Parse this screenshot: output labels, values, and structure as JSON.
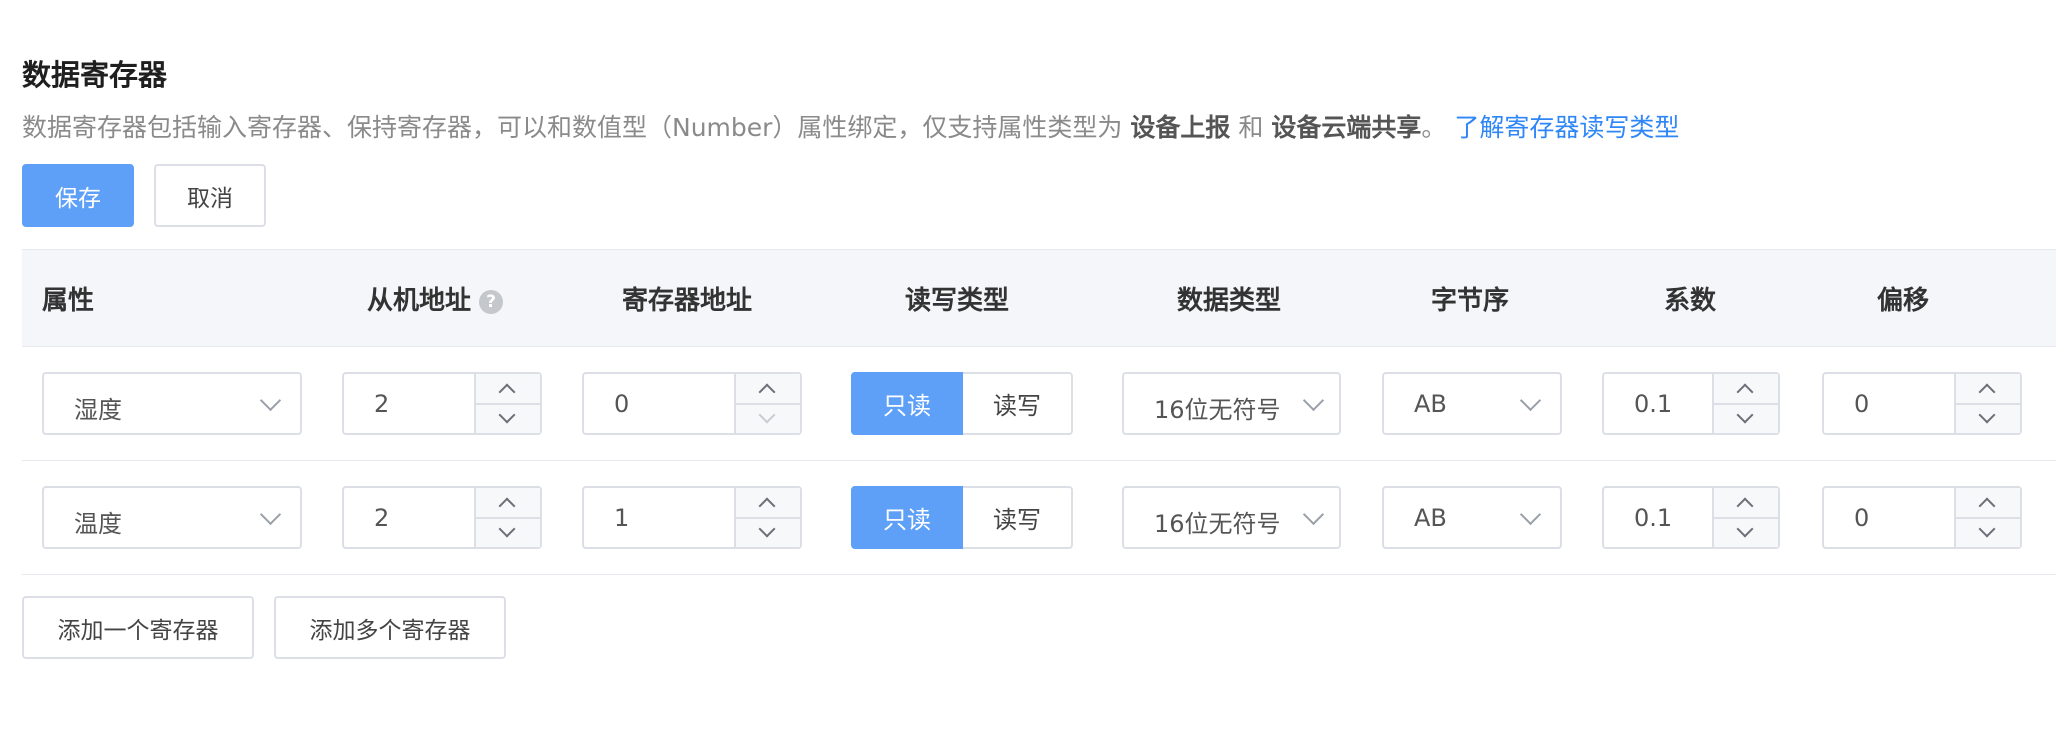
{
  "header": {
    "title": "数据寄存器",
    "desc_prefix": "数据寄存器包括输入寄存器、保持寄存器，可以和数值型（Number）属性绑定，仅支持属性类型为",
    "desc_bold1": "设备上报",
    "desc_and": "和",
    "desc_bold2": "设备云端共享",
    "desc_suffix": "。",
    "desc_link": "了解寄存器读写类型"
  },
  "toolbar": {
    "save_label": "保存",
    "cancel_label": "取消"
  },
  "table": {
    "headers": {
      "property": "属性",
      "slave_address": "从机地址",
      "register_address": "寄存器地址",
      "rw_type": "读写类型",
      "data_type": "数据类型",
      "byte_order": "字节序",
      "coefficient": "系数",
      "offset": "偏移"
    },
    "help_icon": "question-circle-icon",
    "rows": [
      {
        "property": "湿度",
        "slave_address": "2",
        "register_address": "0",
        "rw_readonly": "只读",
        "rw_readwrite": "读写",
        "rw_selected": "只读",
        "data_type": "16位无符号",
        "byte_order": "AB",
        "coefficient": "0.1",
        "offset": "0"
      },
      {
        "property": "温度",
        "slave_address": "2",
        "register_address": "1",
        "rw_readonly": "只读",
        "rw_readwrite": "读写",
        "rw_selected": "只读",
        "data_type": "16位无符号",
        "byte_order": "AB",
        "coefficient": "0.1",
        "offset": "0"
      }
    ]
  },
  "footer": {
    "add_one_label": "添加一个寄存器",
    "add_multi_label": "添加多个寄存器"
  },
  "colors": {
    "primary": "#5ea0f7",
    "link": "#2f86f6",
    "header_bg": "#f4f6f9",
    "border": "#dcdfe6"
  }
}
